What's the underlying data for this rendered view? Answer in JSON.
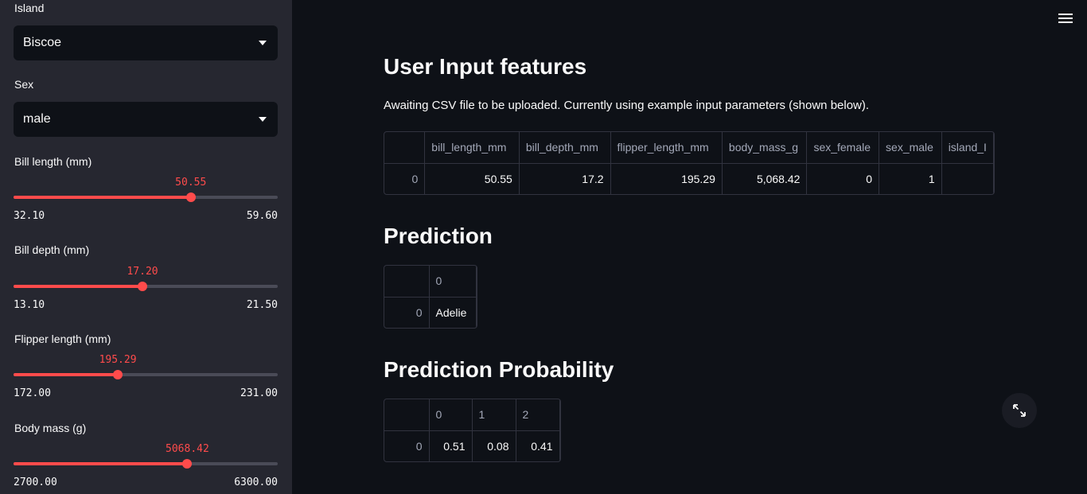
{
  "sidebar": {
    "island": {
      "label": "Island",
      "value": "Biscoe"
    },
    "sex": {
      "label": "Sex",
      "value": "male"
    },
    "sliders": [
      {
        "label": "Bill length (mm)",
        "value_text": "50.55",
        "min_text": "32.10",
        "max_text": "59.60",
        "value": 50.55,
        "min": 32.1,
        "max": 59.6
      },
      {
        "label": "Bill depth (mm)",
        "value_text": "17.20",
        "min_text": "13.10",
        "max_text": "21.50",
        "value": 17.2,
        "min": 13.1,
        "max": 21.5
      },
      {
        "label": "Flipper length (mm)",
        "value_text": "195.29",
        "min_text": "172.00",
        "max_text": "231.00",
        "value": 195.29,
        "min": 172.0,
        "max": 231.0
      },
      {
        "label": "Body mass (g)",
        "value_text": "5068.42",
        "min_text": "2700.00",
        "max_text": "6300.00",
        "value": 5068.42,
        "min": 2700.0,
        "max": 6300.0
      }
    ]
  },
  "main": {
    "input_title": "User Input features",
    "input_caption": "Awaiting CSV file to be uploaded. Currently using example input parameters (shown below).",
    "input_table": {
      "columns": [
        "",
        "bill_length_mm",
        "bill_depth_mm",
        "flipper_length_mm",
        "body_mass_g",
        "sex_female",
        "sex_male",
        "island_I"
      ],
      "rows": [
        [
          "0",
          "50.55",
          "17.2",
          "195.29",
          "5,068.42",
          "0",
          "1",
          ""
        ]
      ]
    },
    "prediction_title": "Prediction",
    "prediction_table": {
      "columns": [
        "",
        "0"
      ],
      "rows": [
        [
          "0",
          "Adelie"
        ]
      ]
    },
    "probability_title": "Prediction Probability",
    "probability_table": {
      "columns": [
        "",
        "0",
        "1",
        "2"
      ],
      "rows": [
        [
          "0",
          "0.51",
          "0.08",
          "0.41"
        ]
      ]
    }
  },
  "colors": {
    "accent": "#ff4b4b",
    "sidebar_bg": "#262730",
    "main_bg": "#0e1117"
  },
  "icons": {
    "menu": "hamburger-menu-icon",
    "expand": "fullscreen-expand-icon",
    "dropdown": "chevron-down-icon"
  }
}
